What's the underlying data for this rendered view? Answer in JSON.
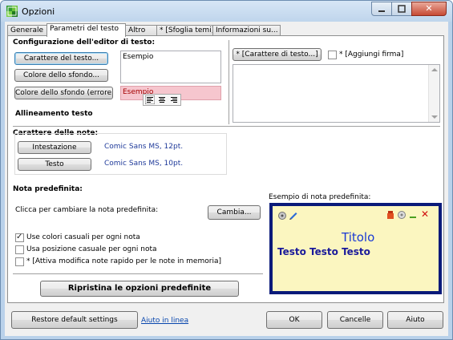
{
  "window": {
    "title": "Opzioni",
    "close_glyph": "✕"
  },
  "tabs": [
    {
      "label": "Generale"
    },
    {
      "label": "Parametri del testo"
    },
    {
      "label": "Altro"
    },
    {
      "label": "* [Sfoglia temi]"
    },
    {
      "label": "Informazioni su..."
    }
  ],
  "editor": {
    "section_title": "Configurazione dell'editor di testo:",
    "font_button": "Carattere del testo...",
    "bg_button": "Colore dello sfondo...",
    "bg_error_button": "Colore dello sfondo (errore)...",
    "sample_text": "Esempio",
    "sample_error_text": "Esempio",
    "align_title": "Allineamento testo",
    "align_icons": [
      "align-left-icon",
      "align-center-icon",
      "align-right-icon"
    ]
  },
  "signature": {
    "font_button": "* [Carattere di testo...]",
    "checkbox_label": "* [Aggiungi firma]",
    "checked": false
  },
  "notes_font": {
    "section_title": "Carattere delle note:",
    "header_button": "Intestazione",
    "header_value": "Comic Sans MS,  12pt.",
    "text_button": "Testo",
    "text_value": "Comic Sans MS,  10pt."
  },
  "default_note": {
    "section_title": "Nota predefinita:",
    "change_text": "Clicca per cambiare la nota predefinita:",
    "change_button": "Cambia...",
    "options": [
      {
        "label": "Use colori casuali per ogni nota",
        "checked": true
      },
      {
        "label": "Usa posizione casuale per ogni nota",
        "checked": false
      },
      {
        "label": "* [Attiva modifica note rapido per le note in memoria]",
        "checked": false
      }
    ],
    "restore_button": "Ripristina le opzioni predefinite",
    "preview_label": "Esempio di nota predefinita:",
    "preview_title": "Titolo",
    "preview_text": "Testo Testo Testo",
    "preview_close": "✕",
    "colors": {
      "border": "#0a1a7a",
      "note_bg": "#fbf6c0",
      "title": "#1a3ad4",
      "text": "#1a1a9a"
    }
  },
  "footer": {
    "restore_button": "Restore default settings",
    "help_link": "Aiuto in linea",
    "ok_button": "OK",
    "cancel_button": "Cancelle",
    "help_button": "Aiuto"
  }
}
